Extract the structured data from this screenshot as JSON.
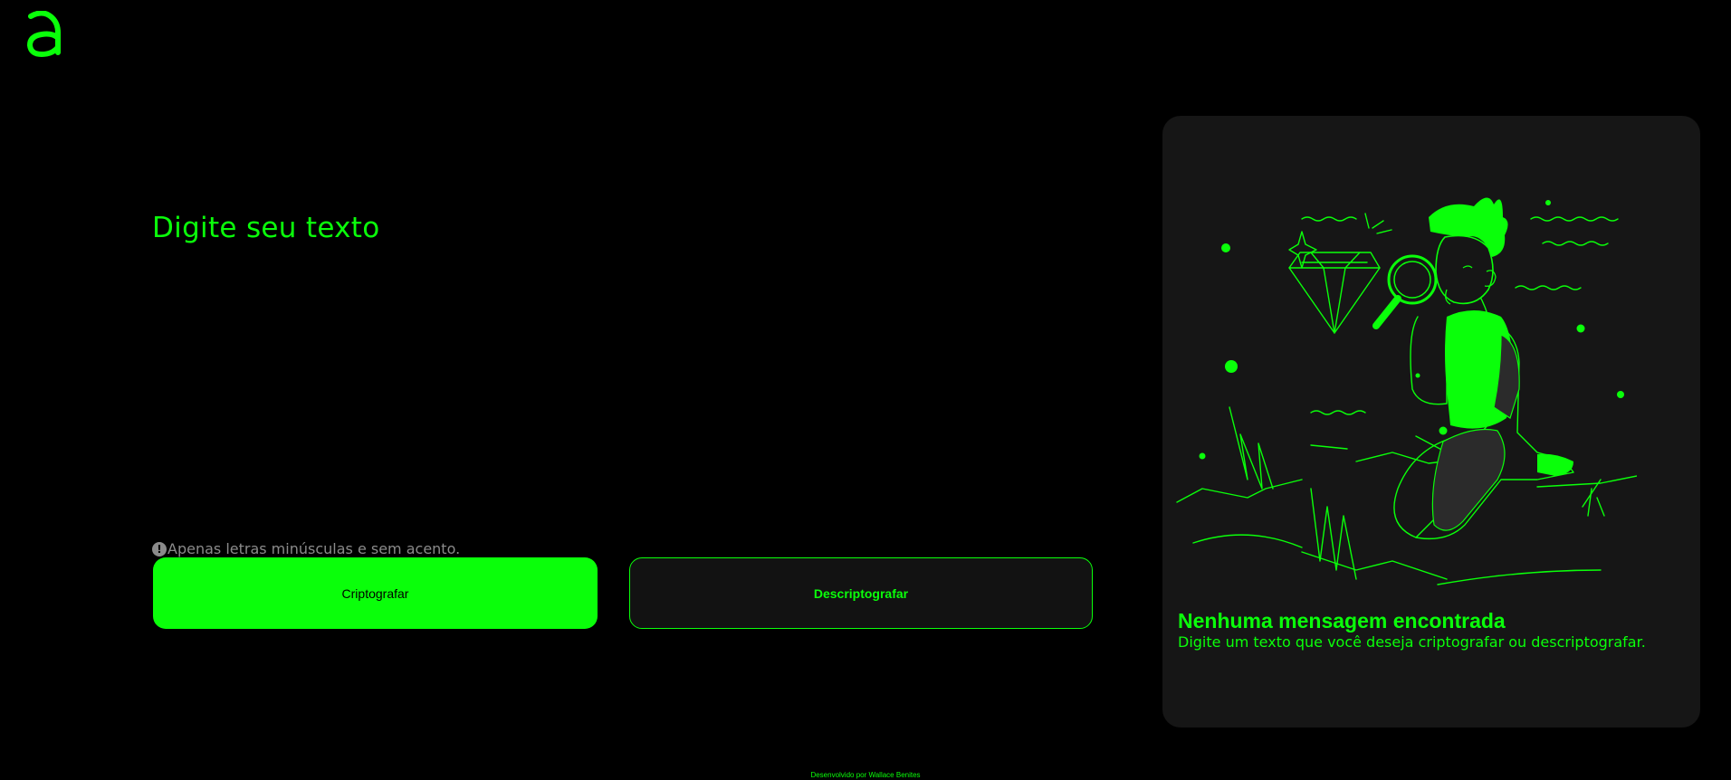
{
  "header": {
    "logo_alt": "a",
    "logo_icon": "alura-logo-icon"
  },
  "input": {
    "placeholder": "Digite seu texto",
    "value": ""
  },
  "hint": {
    "icon": "info-icon",
    "icon_glyph": "!",
    "text": "Apenas letras minúsculas e sem acento."
  },
  "buttons": {
    "encrypt_label": "Criptografar",
    "decrypt_label": "Descriptografar"
  },
  "output": {
    "illustration": "person-with-magnifier-illustration",
    "title": "Nenhuma mensagem encontrada",
    "subtitle": "Digite um texto que você deseja criptografar ou descriptografar."
  },
  "footer": {
    "text": "Desenvolvido por Wallace Benites"
  },
  "colors": {
    "background": "#000000",
    "accent": "#0aff0a",
    "panel": "#161616",
    "hint": "#8a8a8a"
  }
}
